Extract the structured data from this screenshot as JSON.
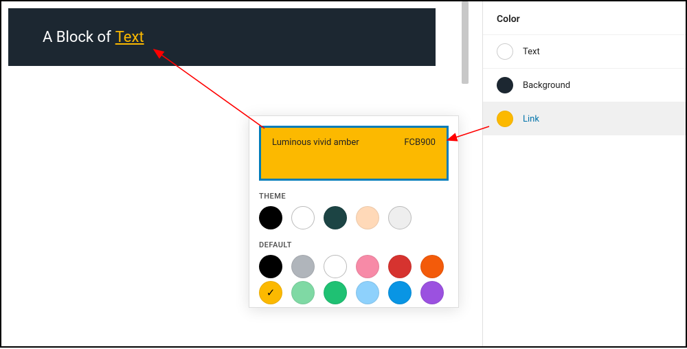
{
  "block": {
    "text_prefix": "A Block of",
    "link_text": "Text"
  },
  "popover": {
    "color_name": "Luminous vivid amber",
    "color_hex": "FCB900",
    "theme_heading": "THEME",
    "default_heading": "DEFAULT",
    "theme_colors": [
      {
        "name": "black",
        "hex": "#000000"
      },
      {
        "name": "white",
        "hex": "#ffffff",
        "bordered": true
      },
      {
        "name": "teal-dark",
        "hex": "#1c4444"
      },
      {
        "name": "peach",
        "hex": "#ffd9b8"
      },
      {
        "name": "light-gray",
        "hex": "#eeeeee",
        "bordered": true
      }
    ],
    "default_colors_row1": [
      {
        "name": "black",
        "hex": "#000000"
      },
      {
        "name": "gray",
        "hex": "#b0b5bb"
      },
      {
        "name": "white",
        "hex": "#ffffff",
        "bordered": true
      },
      {
        "name": "pink",
        "hex": "#f78aa7"
      },
      {
        "name": "red",
        "hex": "#d6332f"
      },
      {
        "name": "orange",
        "hex": "#f35b0a"
      }
    ],
    "default_colors_row2": [
      {
        "name": "amber",
        "hex": "#fcb900",
        "selected": true
      },
      {
        "name": "mint",
        "hex": "#7fd9a4"
      },
      {
        "name": "green",
        "hex": "#1fc173"
      },
      {
        "name": "sky",
        "hex": "#8ed1fc"
      },
      {
        "name": "blue",
        "hex": "#0995e4"
      },
      {
        "name": "purple",
        "hex": "#9b51e0"
      }
    ]
  },
  "sidebar": {
    "title": "Color",
    "rows": [
      {
        "label": "Text",
        "swatch": "#ffffff",
        "bordered": true
      },
      {
        "label": "Background",
        "swatch": "#1c2731"
      },
      {
        "label": "Link",
        "swatch": "#fcb900",
        "selected": true,
        "link_style": true
      }
    ]
  }
}
